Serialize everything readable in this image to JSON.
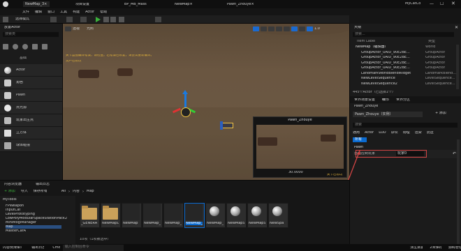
{
  "window": {
    "active_tab": "NewMap_3×",
    "tabs": [
      "项目设置",
      "BP_MB_Mass",
      "NewMap×",
      "Pawn_Zhouye×"
    ],
    "user": "MyCatCo"
  },
  "menu": [
    "文件",
    "编辑",
    "窗口",
    "工具",
    "构建",
    "Actor",
    "帮助"
  ],
  "toolbar": {
    "mode": "选择模式",
    "play_icon": "play-icon"
  },
  "place_actors": {
    "title": "放置Actor",
    "search_placeholder": "搜索类",
    "basic_label": "基础",
    "items": [
      "Actor",
      "角色",
      "Pawn",
      "点光源",
      "玩家出生点",
      "立方体",
      "球体碰撞"
    ]
  },
  "viewport": {
    "perspective": "透视",
    "lit": "光照",
    "overlay_text_line1": "关卡蓝图编译错误，请检查。若错误已修复，请尝试重新编译。",
    "overlay_text_line2": "资产已修改",
    "speed": "1.0",
    "preview_title": "Pawn_Zhouye",
    "preview_info": "30.0000",
    "warning": "关卡已修改"
  },
  "outliner": {
    "title": "大纲",
    "search_placeholder": "搜索...",
    "col_label": "Item Label",
    "col_type": "类型",
    "rows": [
      {
        "label": "NewMap（编辑器）",
        "type": "World"
      },
      {
        "label": "GroupActor_UAID_90E2BE...",
        "type": "GroupActor"
      },
      {
        "label": "GroupActor_UAID_90E2BE...",
        "type": "GroupActor"
      },
      {
        "label": "GroupActor_UAID_90E2BE...",
        "type": "GroupActor"
      },
      {
        "label": "GroupActor_UAID_90E2BE...",
        "type": "GroupActor"
      },
      {
        "label": "LandmarkWorldBlendWidget",
        "type": "LandmarkBlend..."
      },
      {
        "label": "NewLevelSequence",
        "type": "LevelSequence..."
      },
      {
        "label": "NewLevelSequence2",
        "type": "LevelSequence..."
      }
    ],
    "count": "445个Actor（已选择1个）"
  },
  "details": {
    "tab_settings": "世界场景设置",
    "tab_details": "细节",
    "tab_other": "世界分区",
    "actor_name": "Pawn_Zhouye",
    "actor_label": "Pawn_Zhouye（实例）",
    "add_button": "+ 添加",
    "search_placeholder": "搜索",
    "filter_tabs": [
      "通用",
      "Actor",
      "LOD",
      "杂项",
      "物理",
      "渲染",
      "流送",
      "所有"
    ],
    "active_filter": "所有",
    "section": "Pawn",
    "property_label": "自动控制玩家",
    "property_value": "玩家0"
  },
  "content_browser": {
    "title": "内容浏览器",
    "tab2": "输出日志",
    "add_button": "+ 添加",
    "import_button": "导入",
    "save_button": "保存所有",
    "breadcrumb": [
      "All",
      "内容",
      "Map"
    ],
    "tree_root": "MyTools",
    "tree_items": [
      "FPWeapon",
      "InputCat",
      "LevelPrototyping",
      "LowPolyModularSpaceStationPack2",
      "MiniMogiManager",
      "Map",
      "MasterCarA"
    ],
    "assets": [
      {
        "name": "_GENERATED",
        "kind": "folder"
      },
      {
        "name": "NewMapDir",
        "kind": "folder"
      },
      {
        "name": "NewMap",
        "kind": "map"
      },
      {
        "name": "NewMap_2",
        "kind": "map"
      },
      {
        "name": "NewMap_3",
        "kind": "map"
      },
      {
        "name": "NewMap_4",
        "kind": "map",
        "selected": true
      },
      {
        "name": "NewMap_5",
        "kind": "sphere"
      },
      {
        "name": "NewMapSky",
        "kind": "sphere"
      },
      {
        "name": "NewMapSky2",
        "kind": "sphere"
      },
      {
        "name": "NewSpa",
        "kind": "sphere"
      }
    ],
    "count": "10项（1项被选中）"
  },
  "statusbar": {
    "left": "内容侧滑菜单",
    "log": "输出日志",
    "cmd": "Cmd",
    "input_placeholder": "输入控制台命令",
    "derived": "派生数据",
    "save": "2未保存",
    "source": "源码管理"
  },
  "colors": {
    "accent": "#d24545",
    "selected_blue": "#0b6bd0",
    "play_green": "#3bb03b",
    "gizmo_blue": "#1a7ae0"
  }
}
